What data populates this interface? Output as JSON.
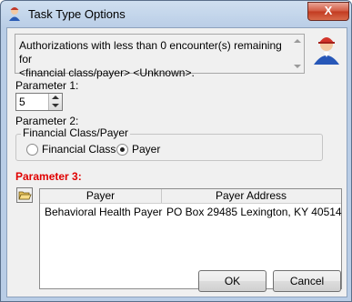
{
  "window": {
    "title": "Task Type Options",
    "close_label": "X"
  },
  "description": {
    "text": "Authorizations with less than 0 encounter(s) remaining for\n<financial class/payer> <Unknown>."
  },
  "parameter1": {
    "label": "Parameter 1:",
    "value": "5"
  },
  "parameter2": {
    "label": "Parameter 2:",
    "group_title": "Financial Class/Payer",
    "options": [
      {
        "label": "Financial Class",
        "selected": false
      },
      {
        "label": "Payer",
        "selected": true
      }
    ]
  },
  "parameter3": {
    "label": "Parameter 3:",
    "columns": [
      "Payer",
      "Payer Address"
    ],
    "rows": [
      {
        "payer": "Behavioral Health Payer",
        "address": "PO Box 29485 Lexington, KY 40514"
      }
    ]
  },
  "buttons": {
    "ok": "OK",
    "cancel": "Cancel"
  },
  "colors": {
    "required_label": "#e00000",
    "close_button": "#c23a20"
  }
}
